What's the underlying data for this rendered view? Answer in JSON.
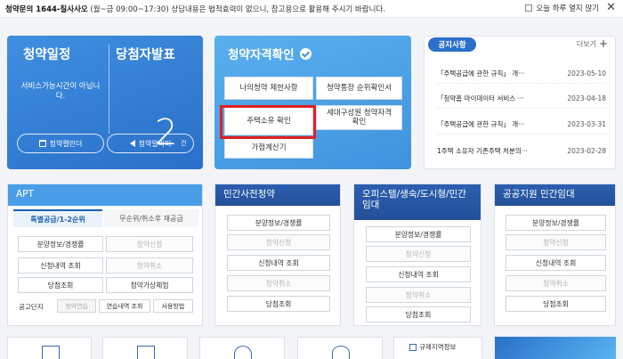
{
  "notice_bar": {
    "lead": "청약문의 1644-칠사사오",
    "text": " (월~금 09:00~17:30) 상담내용은 법적효력이 없으니, 참고용으로 활용해 주시기 바랍니다.",
    "dismiss_label": "오늘 하루 열지 않기",
    "close_glyph": "✕"
  },
  "schedule": {
    "left_title": "청약일정",
    "right_title": "당첨자발표",
    "message": "서비스가능시간이 아닙니다.",
    "count": "2",
    "count_unit": "건",
    "calendar_btn": "청약캘린더",
    "alarm_btn": "청약알리미"
  },
  "qualification": {
    "title": "청약자격확인",
    "buttons": {
      "my_limit": "나의청약 제한사항",
      "account_rank": "청약통장 순위확인서",
      "house_own": "주택소유 확인",
      "household": "세대구성원 청약자격확인",
      "score_calc": "가점계산기"
    }
  },
  "news": {
    "tab_label": "공지사항",
    "more_label": "더보기",
    "items": [
      {
        "title": "「주택공급에 관한 규칙」 개···",
        "date": "2023-05-10"
      },
      {
        "title": "「청약홈 마이데이터 서비스 ···",
        "date": "2023-04-18"
      },
      {
        "title": "「주택공급에 관한 규칙」 개···",
        "date": "2023-03-31"
      },
      {
        "title": "1주택 소유자 기존주택 처분의···",
        "date": "2023-02-28"
      }
    ]
  },
  "apt": {
    "title": "APT",
    "tab_special": "특별공급/1-2순위",
    "tab_random": "무순위/취소후 재공급",
    "rows": [
      [
        "분양정보/경쟁률",
        "청약신청"
      ],
      [
        "신청내역 조회",
        "청약취소"
      ],
      [
        "당첨조회",
        "청약가상체험"
      ]
    ],
    "notice_label": "공고단지",
    "practice": [
      "청약연습",
      "연습내역 조회",
      "사용방법"
    ]
  },
  "presale": {
    "title": "민간사전청약",
    "items": [
      "분양정보/경쟁률",
      "청약신청",
      "신청내역 조회",
      "청약취소",
      "당첨조회"
    ]
  },
  "officetel": {
    "title": "오피스텔/생숙/도시형/민간임대",
    "items": [
      "분양정보/경쟁률",
      "청약신청",
      "신청내역 조회",
      "청약취소",
      "당첨조회"
    ]
  },
  "public": {
    "title": "공공지원 민간임대",
    "items": [
      "분양정보/경쟁률",
      "청약신청",
      "신청내역 조회",
      "청약취소",
      "당첨조회"
    ]
  },
  "strip": {
    "regulated_label": "규제지역정보"
  },
  "colors": {
    "primary": "#2a6fc9",
    "highlight": "#e02020",
    "apt_header": "#4a9ee8",
    "dark_header": "#23509a"
  }
}
